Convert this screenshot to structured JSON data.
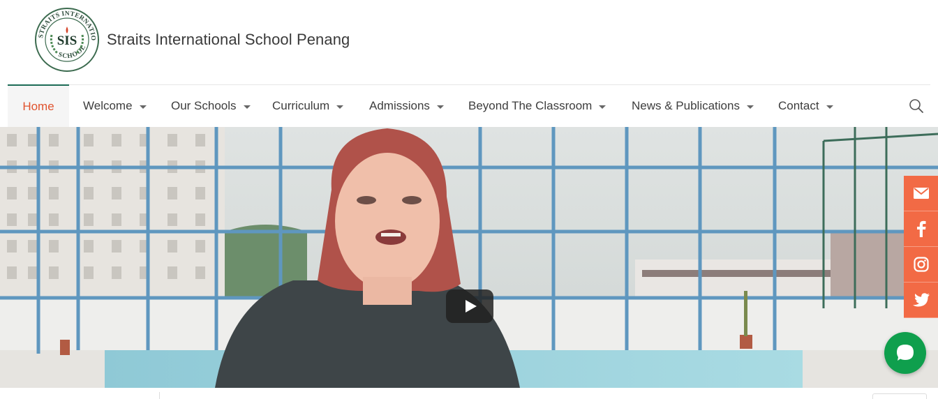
{
  "header": {
    "site_title": "Straits International School Penang",
    "logo": {
      "monogram": "SIS",
      "ring_text_top": "STRAITS INTERNATIONAL",
      "ring_text_bottom": "SCHOOL"
    }
  },
  "nav": {
    "items": [
      {
        "label": "Home",
        "active": true,
        "has_dropdown": false
      },
      {
        "label": "Welcome",
        "has_dropdown": true
      },
      {
        "label": "Our Schools",
        "has_dropdown": true
      },
      {
        "label": "Curriculum",
        "has_dropdown": true
      },
      {
        "label": "Admissions",
        "has_dropdown": true
      },
      {
        "label": "Beyond The Classroom",
        "has_dropdown": true
      },
      {
        "label": "News & Publications",
        "has_dropdown": true
      },
      {
        "label": "Contact",
        "has_dropdown": true
      }
    ],
    "search_icon": "search-icon"
  },
  "hero": {
    "type": "video",
    "play_icon": "play-icon"
  },
  "social": {
    "items": [
      {
        "icon": "email-icon"
      },
      {
        "icon": "facebook-icon"
      },
      {
        "icon": "instagram-icon"
      },
      {
        "icon": "twitter-icon"
      }
    ]
  },
  "chat": {
    "icon": "chat-icon"
  },
  "colors": {
    "accent": "#e0532e",
    "nav_active_border": "#1c6b55",
    "social_bg": "#f26a45",
    "chat_bg": "#0f9f4d"
  }
}
